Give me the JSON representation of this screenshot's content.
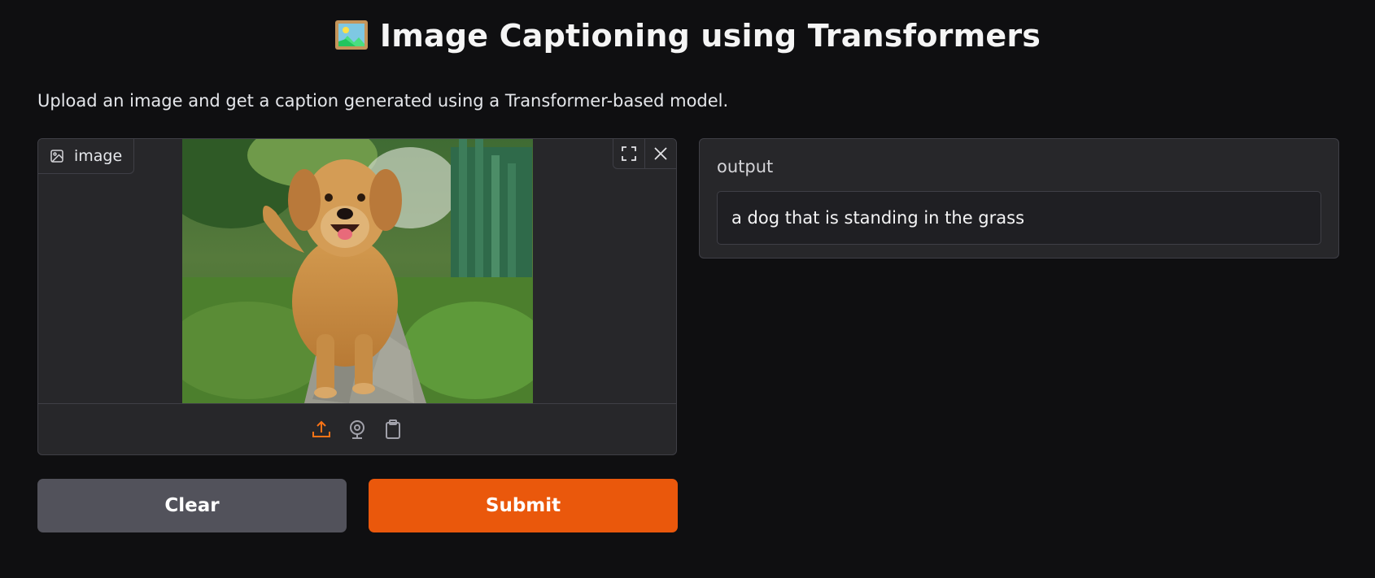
{
  "header": {
    "title": "Image Captioning using Transformers",
    "title_icon": "framed-picture-icon",
    "description": "Upload an image and get a caption generated using a Transformer-based model."
  },
  "image_input": {
    "label": "image",
    "label_icon": "image-icon",
    "preview_subject": "golden-retriever-dog-photo",
    "actions": [
      "fullscreen-icon",
      "close-icon"
    ],
    "sources": [
      "upload-icon",
      "webcam-icon",
      "clipboard-icon"
    ],
    "active_source_color": "#f97316"
  },
  "output": {
    "label": "output",
    "value": "a dog that is standing in the grass"
  },
  "buttons": {
    "clear_label": "Clear",
    "submit_label": "Submit"
  },
  "colors": {
    "background": "#0f0f11",
    "panel": "#27272a",
    "submit": "#ea580c",
    "clear": "#52525b"
  }
}
